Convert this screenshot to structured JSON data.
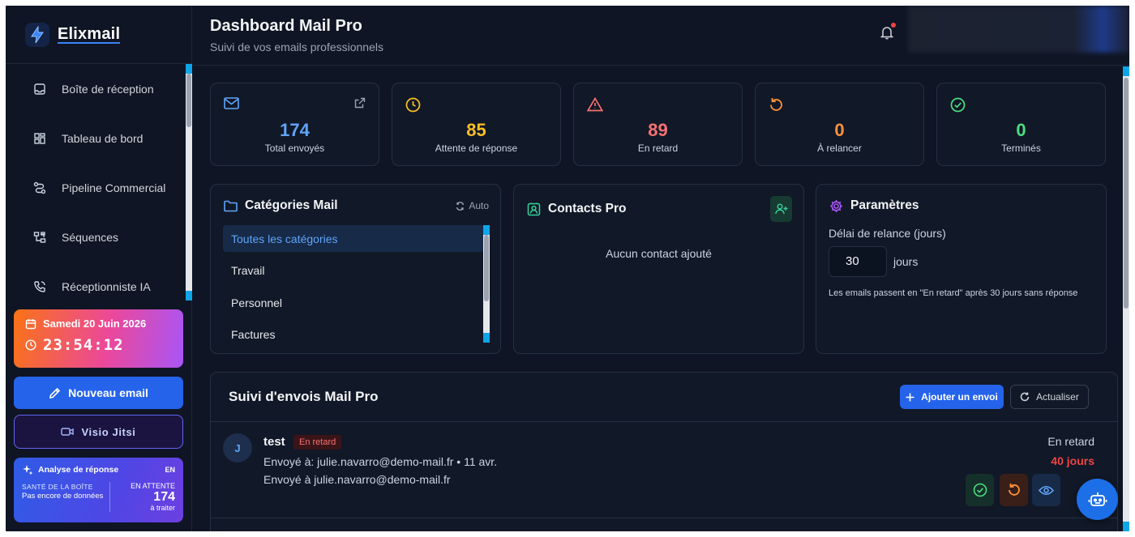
{
  "app": {
    "logo_text": "Elixmail"
  },
  "sidebar": {
    "items": [
      {
        "label": "Boîte de réception",
        "icon": "inbox-icon"
      },
      {
        "label": "Tableau de bord",
        "icon": "dashboard-grid-icon"
      },
      {
        "label": "Pipeline Commercial",
        "icon": "route-icon"
      },
      {
        "label": "Séquences",
        "icon": "workflow-icon"
      },
      {
        "label": "Réceptionniste IA",
        "icon": "phone-icon"
      }
    ],
    "date": "Samedi 20 Juin 2026",
    "time": "23:54:12",
    "new_email_label": "Nouveau email",
    "visio_label": "Visio Jitsi",
    "analyse": {
      "title": "Analyse de réponse",
      "lang": "EN",
      "health_caption": "SANTÉ DE LA BOÎTE",
      "health_value": "Pas encore de données",
      "pending_caption": "EN ATTENTE",
      "pending_count": "174",
      "pending_sub": "à traiter"
    }
  },
  "header": {
    "title": "Dashboard Mail Pro",
    "subtitle": "Suivi de vos emails professionnels"
  },
  "stats": [
    {
      "value": "174",
      "label": "Total envoyés",
      "color": "#60a5fa"
    },
    {
      "value": "85",
      "label": "Attente de réponse",
      "color": "#fbbf24"
    },
    {
      "value": "89",
      "label": "En retard",
      "color": "#f87171"
    },
    {
      "value": "0",
      "label": "À relancer",
      "color": "#fb923c"
    },
    {
      "value": "0",
      "label": "Terminés",
      "color": "#4ade80"
    }
  ],
  "categories": {
    "title": "Catégories Mail",
    "auto_label": "Auto",
    "items": [
      "Toutes les catégories",
      "Travail",
      "Personnel",
      "Factures"
    ]
  },
  "contacts": {
    "title": "Contacts Pro",
    "empty_text": "Aucun contact ajouté"
  },
  "params": {
    "title": "Paramètres",
    "delay_label": "Délai de relance (jours)",
    "delay_value": "30",
    "unit": "jours",
    "note": "Les emails passent en \"En retard\" après 30 jours sans réponse"
  },
  "suivi": {
    "title": "Suivi d'envois Mail Pro",
    "add_label": "Ajouter un envoi",
    "refresh_label": "Actualiser",
    "rows": [
      {
        "avatar": "J",
        "name": "test",
        "badge": "En retard",
        "line1": "Envoyé à: julie.navarro@demo-mail.fr • 11 avr.",
        "line2": "Envoyé à julie.navarro@demo-mail.fr",
        "status": "En retard",
        "days": "40 jours"
      }
    ]
  }
}
